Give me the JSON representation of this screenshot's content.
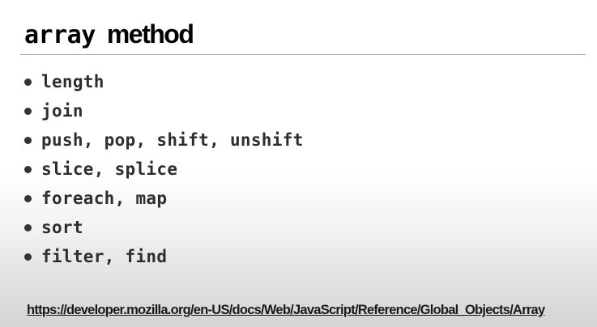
{
  "slide": {
    "title_code": "array",
    "title_text": "method",
    "bullets": [
      "length",
      "join",
      "push, pop, shift, unshift",
      "slice, splice",
      "foreach, map",
      "sort",
      "filter, find"
    ],
    "reference_link": "https://developer.mozilla.org/en-US/docs/Web/JavaScript/Reference/Global_Objects/Array"
  }
}
